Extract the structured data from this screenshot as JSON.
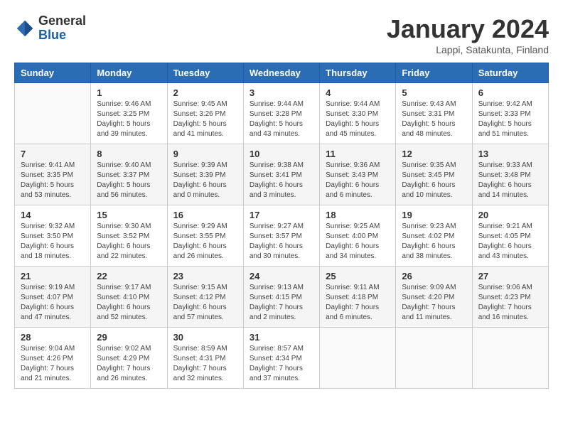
{
  "header": {
    "logo": {
      "general": "General",
      "blue": "Blue"
    },
    "title": "January 2024",
    "subtitle": "Lappi, Satakunta, Finland"
  },
  "weekdays": [
    "Sunday",
    "Monday",
    "Tuesday",
    "Wednesday",
    "Thursday",
    "Friday",
    "Saturday"
  ],
  "weeks": [
    [
      {
        "day": "",
        "sunrise": "",
        "sunset": "",
        "daylight": ""
      },
      {
        "day": "1",
        "sunrise": "Sunrise: 9:46 AM",
        "sunset": "Sunset: 3:25 PM",
        "daylight": "Daylight: 5 hours and 39 minutes."
      },
      {
        "day": "2",
        "sunrise": "Sunrise: 9:45 AM",
        "sunset": "Sunset: 3:26 PM",
        "daylight": "Daylight: 5 hours and 41 minutes."
      },
      {
        "day": "3",
        "sunrise": "Sunrise: 9:44 AM",
        "sunset": "Sunset: 3:28 PM",
        "daylight": "Daylight: 5 hours and 43 minutes."
      },
      {
        "day": "4",
        "sunrise": "Sunrise: 9:44 AM",
        "sunset": "Sunset: 3:30 PM",
        "daylight": "Daylight: 5 hours and 45 minutes."
      },
      {
        "day": "5",
        "sunrise": "Sunrise: 9:43 AM",
        "sunset": "Sunset: 3:31 PM",
        "daylight": "Daylight: 5 hours and 48 minutes."
      },
      {
        "day": "6",
        "sunrise": "Sunrise: 9:42 AM",
        "sunset": "Sunset: 3:33 PM",
        "daylight": "Daylight: 5 hours and 51 minutes."
      }
    ],
    [
      {
        "day": "7",
        "sunrise": "Sunrise: 9:41 AM",
        "sunset": "Sunset: 3:35 PM",
        "daylight": "Daylight: 5 hours and 53 minutes."
      },
      {
        "day": "8",
        "sunrise": "Sunrise: 9:40 AM",
        "sunset": "Sunset: 3:37 PM",
        "daylight": "Daylight: 5 hours and 56 minutes."
      },
      {
        "day": "9",
        "sunrise": "Sunrise: 9:39 AM",
        "sunset": "Sunset: 3:39 PM",
        "daylight": "Daylight: 6 hours and 0 minutes."
      },
      {
        "day": "10",
        "sunrise": "Sunrise: 9:38 AM",
        "sunset": "Sunset: 3:41 PM",
        "daylight": "Daylight: 6 hours and 3 minutes."
      },
      {
        "day": "11",
        "sunrise": "Sunrise: 9:36 AM",
        "sunset": "Sunset: 3:43 PM",
        "daylight": "Daylight: 6 hours and 6 minutes."
      },
      {
        "day": "12",
        "sunrise": "Sunrise: 9:35 AM",
        "sunset": "Sunset: 3:45 PM",
        "daylight": "Daylight: 6 hours and 10 minutes."
      },
      {
        "day": "13",
        "sunrise": "Sunrise: 9:33 AM",
        "sunset": "Sunset: 3:48 PM",
        "daylight": "Daylight: 6 hours and 14 minutes."
      }
    ],
    [
      {
        "day": "14",
        "sunrise": "Sunrise: 9:32 AM",
        "sunset": "Sunset: 3:50 PM",
        "daylight": "Daylight: 6 hours and 18 minutes."
      },
      {
        "day": "15",
        "sunrise": "Sunrise: 9:30 AM",
        "sunset": "Sunset: 3:52 PM",
        "daylight": "Daylight: 6 hours and 22 minutes."
      },
      {
        "day": "16",
        "sunrise": "Sunrise: 9:29 AM",
        "sunset": "Sunset: 3:55 PM",
        "daylight": "Daylight: 6 hours and 26 minutes."
      },
      {
        "day": "17",
        "sunrise": "Sunrise: 9:27 AM",
        "sunset": "Sunset: 3:57 PM",
        "daylight": "Daylight: 6 hours and 30 minutes."
      },
      {
        "day": "18",
        "sunrise": "Sunrise: 9:25 AM",
        "sunset": "Sunset: 4:00 PM",
        "daylight": "Daylight: 6 hours and 34 minutes."
      },
      {
        "day": "19",
        "sunrise": "Sunrise: 9:23 AM",
        "sunset": "Sunset: 4:02 PM",
        "daylight": "Daylight: 6 hours and 38 minutes."
      },
      {
        "day": "20",
        "sunrise": "Sunrise: 9:21 AM",
        "sunset": "Sunset: 4:05 PM",
        "daylight": "Daylight: 6 hours and 43 minutes."
      }
    ],
    [
      {
        "day": "21",
        "sunrise": "Sunrise: 9:19 AM",
        "sunset": "Sunset: 4:07 PM",
        "daylight": "Daylight: 6 hours and 47 minutes."
      },
      {
        "day": "22",
        "sunrise": "Sunrise: 9:17 AM",
        "sunset": "Sunset: 4:10 PM",
        "daylight": "Daylight: 6 hours and 52 minutes."
      },
      {
        "day": "23",
        "sunrise": "Sunrise: 9:15 AM",
        "sunset": "Sunset: 4:12 PM",
        "daylight": "Daylight: 6 hours and 57 minutes."
      },
      {
        "day": "24",
        "sunrise": "Sunrise: 9:13 AM",
        "sunset": "Sunset: 4:15 PM",
        "daylight": "Daylight: 7 hours and 2 minutes."
      },
      {
        "day": "25",
        "sunrise": "Sunrise: 9:11 AM",
        "sunset": "Sunset: 4:18 PM",
        "daylight": "Daylight: 7 hours and 6 minutes."
      },
      {
        "day": "26",
        "sunrise": "Sunrise: 9:09 AM",
        "sunset": "Sunset: 4:20 PM",
        "daylight": "Daylight: 7 hours and 11 minutes."
      },
      {
        "day": "27",
        "sunrise": "Sunrise: 9:06 AM",
        "sunset": "Sunset: 4:23 PM",
        "daylight": "Daylight: 7 hours and 16 minutes."
      }
    ],
    [
      {
        "day": "28",
        "sunrise": "Sunrise: 9:04 AM",
        "sunset": "Sunset: 4:26 PM",
        "daylight": "Daylight: 7 hours and 21 minutes."
      },
      {
        "day": "29",
        "sunrise": "Sunrise: 9:02 AM",
        "sunset": "Sunset: 4:29 PM",
        "daylight": "Daylight: 7 hours and 26 minutes."
      },
      {
        "day": "30",
        "sunrise": "Sunrise: 8:59 AM",
        "sunset": "Sunset: 4:31 PM",
        "daylight": "Daylight: 7 hours and 32 minutes."
      },
      {
        "day": "31",
        "sunrise": "Sunrise: 8:57 AM",
        "sunset": "Sunset: 4:34 PM",
        "daylight": "Daylight: 7 hours and 37 minutes."
      },
      {
        "day": "",
        "sunrise": "",
        "sunset": "",
        "daylight": ""
      },
      {
        "day": "",
        "sunrise": "",
        "sunset": "",
        "daylight": ""
      },
      {
        "day": "",
        "sunrise": "",
        "sunset": "",
        "daylight": ""
      }
    ]
  ]
}
